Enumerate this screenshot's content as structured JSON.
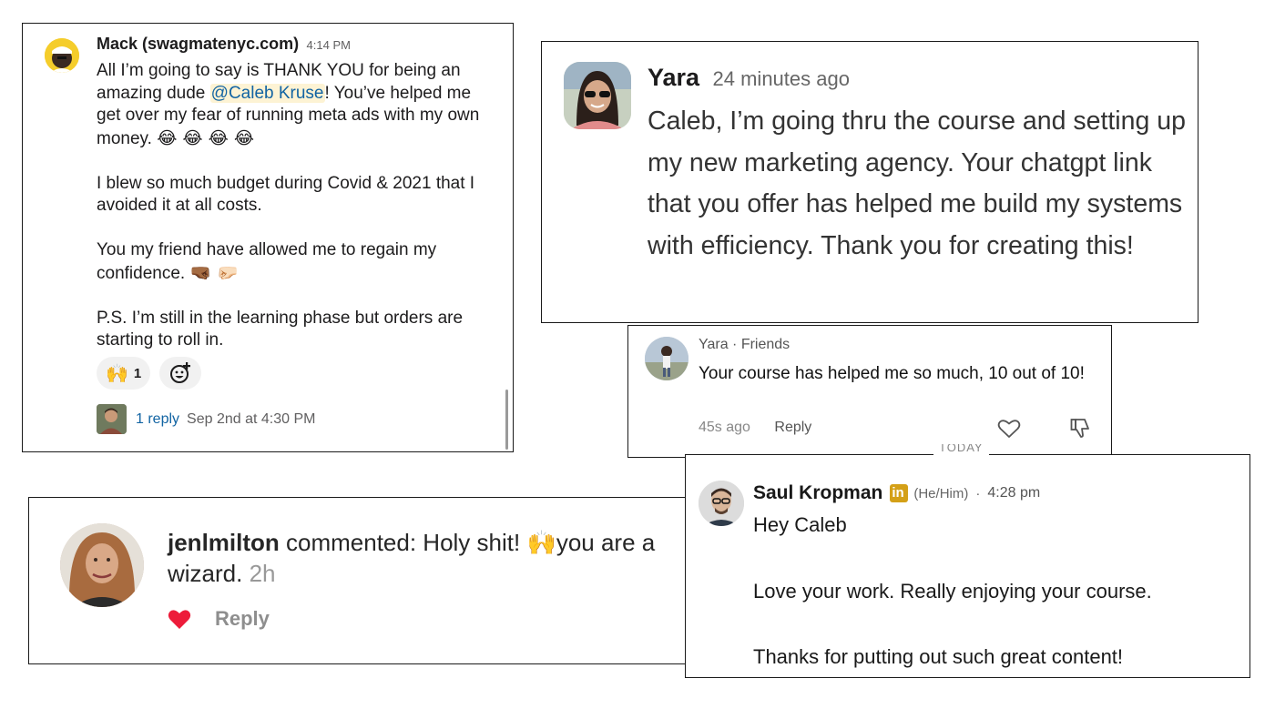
{
  "slack": {
    "name": "Mack (swagmatenyc.com)",
    "time": "4:14 PM",
    "p1_a": "All I’m going to say is THANK YOU for being an amazing dude ",
    "mention": "@Caleb Kruse",
    "p1_b": "! You’ve helped me get over my fear of running meta ads with my own money. ",
    "p1_emoji": "😂 😂 😂 😂",
    "p2": "I blew so much budget during Covid & 2021 that I avoided it at all costs.",
    "p3": "You my friend have allowed me to regain my confidence. ",
    "p3_emoji": "🤜🏾 🤛🏻",
    "p4": "P.S. I’m still in the learning phase but orders are starting to roll in.",
    "reaction_emoji": "🙌",
    "reaction_count": "1",
    "reply_count": "1 reply",
    "reply_date": "Sep 2nd at 4:30 PM",
    "icons": [
      "raised-hands-emoji",
      "add-reaction-icon"
    ]
  },
  "yara_big": {
    "name": "Yara",
    "time": "24 minutes ago",
    "text": "Caleb, I’m going thru the course and setting up my new marketing agency. Your chatgpt link that you offer has helped me build my systems with efficiency. Thank you for creating this!"
  },
  "yara_small": {
    "header": "Yara · Friends",
    "text": "Your course has helped me so much, 10 out of 10!",
    "time": "45s ago",
    "reply": "Reply",
    "icons": [
      "heart-outline-icon",
      "dislike-icon"
    ]
  },
  "instagram": {
    "username": "jenlmilton",
    "text_before": " commented: Holy shit! ",
    "emoji": "🙌",
    "text_after": "you are a wizard.",
    "time": "2h",
    "reply": "Reply",
    "liked_color": "#ed4956"
  },
  "linkedin": {
    "today": "TODAY",
    "name": "Saul Kropman",
    "badge": "in",
    "pronouns": "(He/Him)",
    "dot": "·",
    "time": "4:28 pm",
    "line1": "Hey Caleb",
    "line2": "Love your work. Really enjoying your course.",
    "line3": "Thanks for putting out such great content!",
    "badge_color": "#d4a017"
  }
}
